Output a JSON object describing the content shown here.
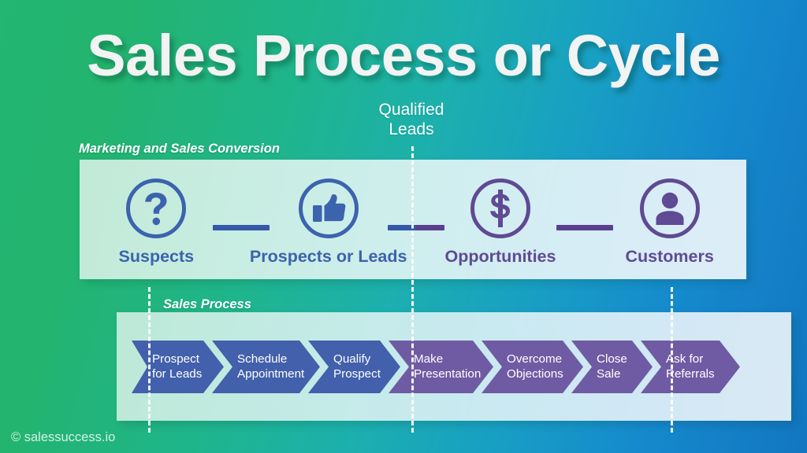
{
  "title": "Sales Process or Cycle",
  "qualified_leads_caption": "Qualified\nLeads",
  "qualified_leads_line1": "Qualified",
  "qualified_leads_line2": "Leads",
  "top_band": {
    "caption": "Marketing and Sales Conversion",
    "stages": [
      {
        "label": "Suspects",
        "icon": "question-mark-circle-icon",
        "color": "#3c63ad"
      },
      {
        "label": "Prospects or Leads",
        "icon": "thumbs-up-circle-icon",
        "color": "#3c63ad"
      },
      {
        "label": "Opportunities",
        "icon": "dollar-sign-circle-icon",
        "color": "#5f4a93"
      },
      {
        "label": "Customers",
        "icon": "person-circle-icon",
        "color": "#5f4a93"
      }
    ],
    "connectors": [
      "#3558a8",
      "#3558a8 to #5b3f8f",
      "#5b3f8f"
    ]
  },
  "bottom_band": {
    "caption": "Sales Process",
    "steps": [
      {
        "line1": "Prospect",
        "line2": "for Leads",
        "color": "#4260ab"
      },
      {
        "line1": "Schedule",
        "line2": "Appointment",
        "color": "#4260ab"
      },
      {
        "line1": "Qualify",
        "line2": "Prospect",
        "color": "#4260ab"
      },
      {
        "line1": "Make",
        "line2": "Presentation",
        "color": "#6f5ba3"
      },
      {
        "line1": "Overcome",
        "line2": "Objections",
        "color": "#6f5ba3"
      },
      {
        "line1": "Close",
        "line2": "Sale",
        "color": "#6f5ba3"
      },
      {
        "line1": "Ask for",
        "line2": "Referrals",
        "color": "#6f5ba3"
      }
    ]
  },
  "watermark": "© salessuccess.io",
  "colors": {
    "background_start": "#22b573",
    "background_end": "#1276c0",
    "blue": "#3c63ad",
    "purple": "#5f4a93",
    "band": "rgba(255,255,255,0.78)"
  }
}
